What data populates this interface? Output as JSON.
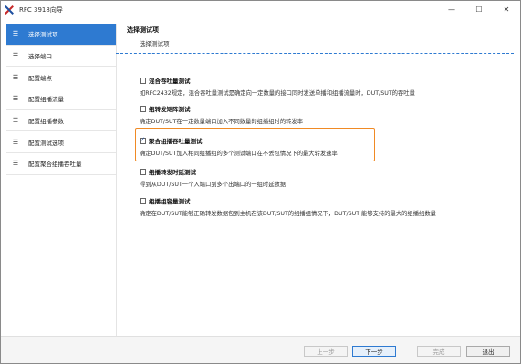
{
  "window": {
    "title": "RFC 3918向导"
  },
  "controls": {
    "minimize": "—",
    "maximize": "☐",
    "close": "✕"
  },
  "sidebar": {
    "items": [
      {
        "label": "选择测试项",
        "active": true
      },
      {
        "label": "选择端口"
      },
      {
        "label": "配置端点"
      },
      {
        "label": "配置组播流量"
      },
      {
        "label": "配置组播参数"
      },
      {
        "label": "配置测试选项"
      },
      {
        "label": "配置聚合组播吞吐量"
      }
    ],
    "bars_glyph": "☰"
  },
  "content": {
    "title": "选择测试项",
    "subtitle": "选择测试项",
    "options": [
      {
        "label": "混合吞吐量测试",
        "checked": false,
        "desc": "如RFC2432规定，混合吞吐量测试是确定向一定数量的接口同时发送单播和组播流量时，DUT/SUT的吞吐量"
      },
      {
        "label": "组转发矩阵测试",
        "checked": false,
        "desc": "确定DUT/SUT在一定数量端口加入不同数量的组播组时的转发率"
      },
      {
        "label": "聚合组播吞吐量测试",
        "checked": true,
        "desc": "确定DUT/SUT加入相同组播组的多个测试端口在不丢包情况下的最大转发速率"
      },
      {
        "label": "组播转发时延测试",
        "checked": false,
        "desc": "得到从DUT/SUT一个入端口到多个出端口的一组时延数据"
      },
      {
        "label": "组播组容量测试",
        "checked": false,
        "desc": "确定在DUT/SUT能够正确转发数据包到主机在该DUT/SUT的组播组情况下，DUT/SUT 能够支持的最大的组播组数量"
      }
    ]
  },
  "footer": {
    "prev": "上一步",
    "next": "下一步",
    "finish": "完成",
    "exit": "退出"
  },
  "colors": {
    "accent": "#2e7ad1",
    "highlight": "#f08a24"
  }
}
